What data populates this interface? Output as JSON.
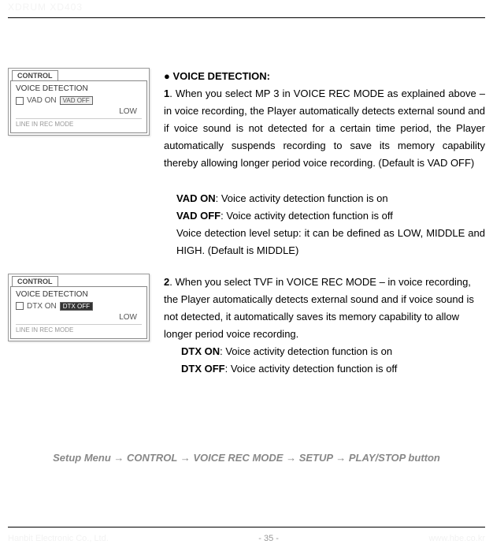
{
  "header": {
    "product": "XDRUM XD403"
  },
  "shots": {
    "tab": "CONTROL",
    "title": "VOICE DETECTION",
    "shot1_label": "VAD ON",
    "shot1_btn": "VAD OFF",
    "shot2_label": "DTX ON",
    "shot2_btn": "DTX OFF",
    "level": "LOW",
    "sub": "LINE IN REC MODE"
  },
  "section": {
    "heading_bullet": "●",
    "heading": "VOICE DETECTION:",
    "item1_num": "1",
    "item1_text": ". When you select MP 3 in VOICE REC MODE as explained above – in voice recording, the Player automatically detects external sound and if voice sound is not detected for a certain time period, the Player automatically suspends recording to save its memory capability thereby allowing longer period voice recording. (Default is VAD OFF)",
    "vad_on_label": "VAD ON",
    "vad_on_text": ": Voice activity detection function is on",
    "vad_off_label": "VAD OFF",
    "vad_off_text": ": Voice activity detection function is off",
    "level_text": "Voice detection level setup: it can be defined as LOW, MIDDLE and HIGH. (Default is MIDDLE)",
    "item2_num": "2",
    "item2_text": ". When you select TVF in VOICE REC MODE – in voice recording, the Player automatically detects external sound and if voice sound is not detected, it automatically saves its memory capability to allow longer period voice recording.",
    "dtx_on_label": "DTX ON",
    "dtx_on_text": ": Voice activity detection function is on",
    "dtx_off_label": "DTX OFF",
    "dtx_off_text": ": Voice activity detection function is off"
  },
  "breadcrumb": {
    "p1": "Setup Menu",
    "arrow": "→",
    "p2": "CONTROL",
    "p3": "VOICE REC MODE",
    "p4": "SETUP",
    "p5": "PLAY/STOP button"
  },
  "footer": {
    "left": "Hanbit Electronic Co., Ltd.",
    "center": "- 35 -",
    "right": "www.hbe.co.kr"
  }
}
